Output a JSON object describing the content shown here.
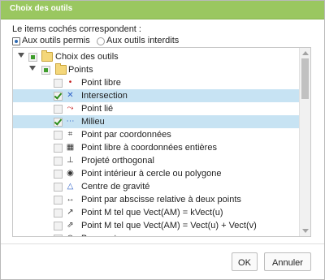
{
  "dialog": {
    "title": "Choix des outils",
    "caption": "Le items cochés correspondent :",
    "radios": [
      {
        "label": "Aux outils permis",
        "checked": true
      },
      {
        "label": "Aux outils interdits",
        "checked": false
      }
    ],
    "tree": {
      "root": {
        "label": "Choix des outils"
      },
      "group": {
        "label": "Points"
      },
      "items": [
        {
          "label": "Point libre",
          "icon": "point-dot-icon",
          "checked": false,
          "selected": false
        },
        {
          "label": "Intersection",
          "icon": "intersection-icon",
          "checked": true,
          "selected": true
        },
        {
          "label": "Point lié",
          "icon": "linked-point-icon",
          "checked": false,
          "selected": false
        },
        {
          "label": "Milieu",
          "icon": "midpoint-icon",
          "checked": true,
          "selected": true
        },
        {
          "label": "Point par coordonnées",
          "icon": "coordinates-point-icon",
          "checked": false,
          "selected": false
        },
        {
          "label": "Point libre à coordonnées entières",
          "icon": "grid-point-icon",
          "checked": false,
          "selected": false
        },
        {
          "label": "Projeté orthogonal",
          "icon": "orthogonal-projection-icon",
          "checked": false,
          "selected": false
        },
        {
          "label": "Point intérieur à cercle ou polygone",
          "icon": "interior-point-icon",
          "checked": false,
          "selected": false
        },
        {
          "label": "Centre de gravité",
          "icon": "centroid-icon",
          "checked": false,
          "selected": false
        },
        {
          "label": "Point par abscisse relative à deux points",
          "icon": "relative-abscissa-icon",
          "checked": false,
          "selected": false
        },
        {
          "label": "Point M tel que Vect(AM) = kVect(u)",
          "icon": "vector-point-icon",
          "checked": false,
          "selected": false
        },
        {
          "label": "Point M tel que Vect(AM) = Vect(u) + Vect(v)",
          "icon": "vector-sum-point-icon",
          "checked": false,
          "selected": false
        },
        {
          "label": "Barycentre",
          "icon": "barycenter-icon",
          "checked": false,
          "selected": false
        }
      ]
    },
    "buttons": {
      "ok": "OK",
      "cancel": "Annuler"
    }
  }
}
